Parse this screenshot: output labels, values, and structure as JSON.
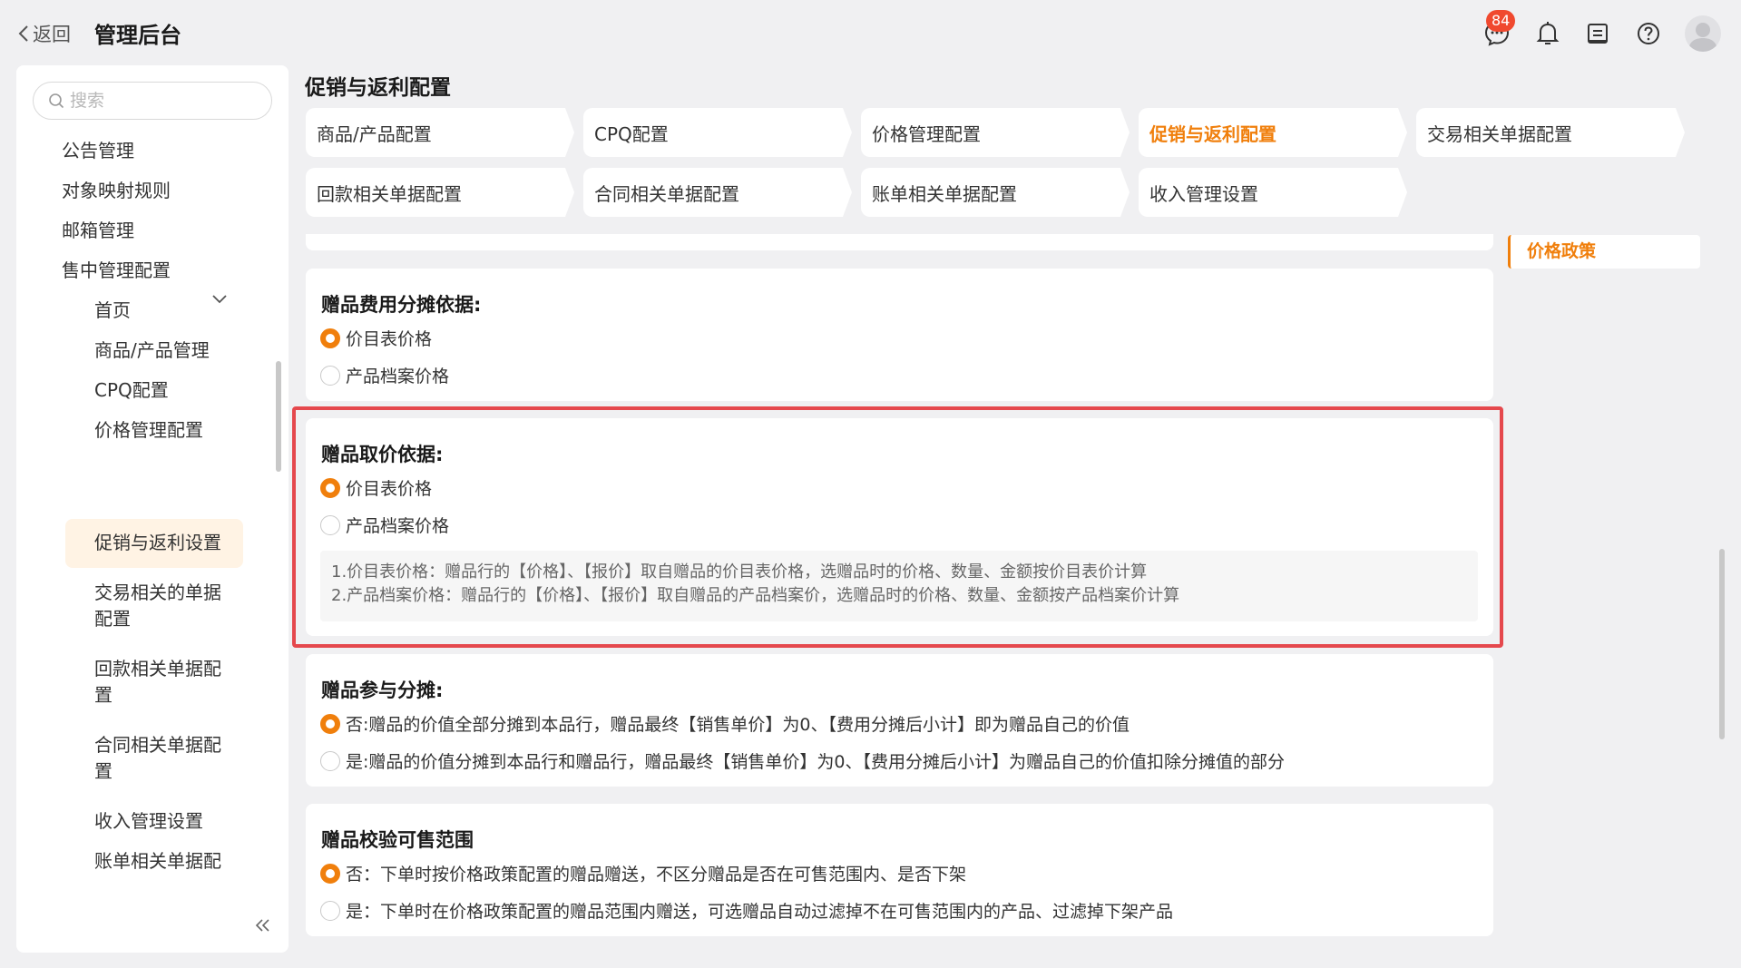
{
  "header": {
    "back_label": "返回",
    "app_title": "管理后台",
    "message_badge": "84",
    "icons": [
      "chat-icon",
      "bell-icon",
      "ledger-icon",
      "help-icon",
      "avatar"
    ]
  },
  "sidebar": {
    "search_placeholder": "搜索",
    "items": [
      {
        "label": "公告管理"
      },
      {
        "label": "对象映射规则"
      },
      {
        "label": "邮箱管理"
      },
      {
        "label": "售中管理配置"
      }
    ],
    "sub_items": [
      {
        "label": "首页"
      },
      {
        "label": "商品/产品管理"
      },
      {
        "label": "CPQ配置"
      },
      {
        "label": "价格管理配置"
      },
      {
        "label": "促销与返利设置",
        "active": true
      },
      {
        "label": "交易相关的单据配置"
      },
      {
        "label": "回款相关单据配置"
      },
      {
        "label": "合同相关单据配置"
      },
      {
        "label": "收入管理设置"
      },
      {
        "label": "账单相关单据配置"
      }
    ]
  },
  "main": {
    "page_title": "促销与返利配置",
    "tabs": [
      {
        "label": "商品/产品配置"
      },
      {
        "label": "CPQ配置"
      },
      {
        "label": "价格管理配置"
      },
      {
        "label": "促销与返利配置",
        "active": true
      },
      {
        "label": "交易相关单据配置"
      },
      {
        "label": "回款相关单据配置"
      },
      {
        "label": "合同相关单据配置"
      },
      {
        "label": "账单相关单据配置"
      },
      {
        "label": "收入管理设置"
      }
    ],
    "sections": [
      {
        "title": "赠品费用分摊依据:",
        "options": [
          {
            "label": "价目表价格",
            "selected": true
          },
          {
            "label": "产品档案价格",
            "selected": false
          }
        ]
      },
      {
        "title": "赠品取价依据:",
        "options": [
          {
            "label": "价目表价格",
            "selected": true
          },
          {
            "label": "产品档案价格",
            "selected": false
          }
        ],
        "hint_lines": [
          "1.价目表价格：赠品行的【价格】、【报价】取自赠品的价目表价格，选赠品时的价格、数量、金额按价目表价计算",
          "2.产品档案价格：赠品行的【价格】、【报价】取自赠品的产品档案价，选赠品时的价格、数量、金额按产品档案价计算"
        ]
      },
      {
        "title": "赠品参与分摊:",
        "options": [
          {
            "label": "否:赠品的价值全部分摊到本品行，赠品最终【销售单价】为0、【费用分摊后小计】即为赠品自己的价值",
            "selected": true
          },
          {
            "label": "是:赠品的价值分摊到本品行和赠品行，赠品最终【销售单价】为0、【费用分摊后小计】为赠品自己的价值扣除分摊值的部分",
            "selected": false
          }
        ]
      },
      {
        "title": "赠品校验可售范围",
        "options": [
          {
            "label": "否：下单时按价格政策配置的赠品赠送，不区分赠品是否在可售范围内、是否下架",
            "selected": true
          },
          {
            "label": "是：下单时在价格政策配置的赠品范围内赠送，可选赠品自动过滤掉不在可售范围内的产品、过滤掉下架产品",
            "selected": false
          }
        ]
      }
    ],
    "anchor_label": "价格政策"
  },
  "colors": {
    "accent": "#f07f0c",
    "highlight_border": "#e5484d",
    "badge": "#f0492f"
  }
}
